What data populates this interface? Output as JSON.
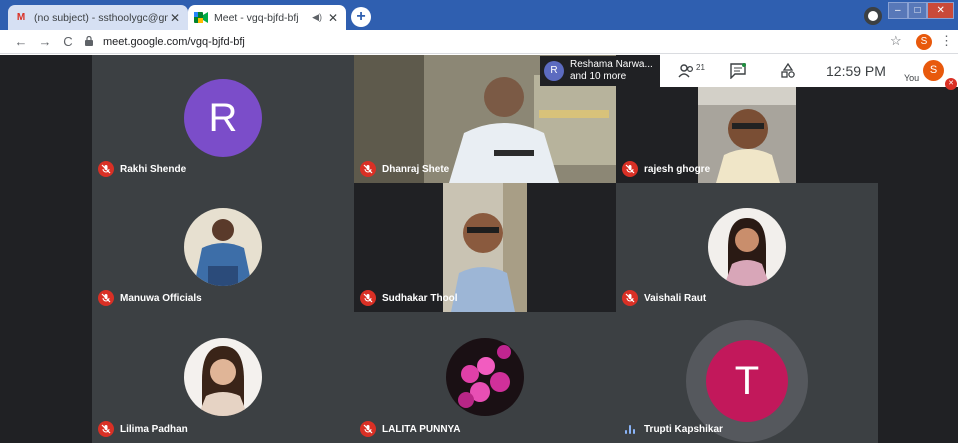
{
  "browser": {
    "tabs": [
      {
        "title": "(no subject) - ssthoolygc@gmail",
        "favicon": "gmail-icon",
        "active": false
      },
      {
        "title": "Meet - vgq-bjfd-bfj",
        "favicon": "meet-icon",
        "active": true
      }
    ],
    "url": "meet.google.com/vgq-bjfd-bfj",
    "profile_initial": "S"
  },
  "meet": {
    "presenter": {
      "initial": "R",
      "line1": "Reshama Narwa...",
      "line2": "and 10 more"
    },
    "people_count": "21",
    "time": "12:59 PM",
    "you_label": "You",
    "self_initial": "S",
    "participants": [
      {
        "name": "Rakhi Shende",
        "initial": "R",
        "muted": true
      },
      {
        "name": "Dhanraj Shete",
        "muted": true
      },
      {
        "name": "rajesh ghogre",
        "muted": true
      },
      {
        "name": "Manuwa Officials",
        "muted": true
      },
      {
        "name": "Sudhakar Thool",
        "muted": true
      },
      {
        "name": "Vaishali Raut",
        "muted": true
      },
      {
        "name": "Lilima Padhan",
        "muted": true
      },
      {
        "name": "LALITA PUNNYA",
        "muted": true
      },
      {
        "name": "Trupti Kapshikar",
        "initial": "T",
        "muted": false
      }
    ]
  },
  "colors": {
    "meet_bg": "#202124",
    "tile_bg": "#3c4043",
    "avatar_purple": "#7b4dc9",
    "avatar_pink": "#c2185b",
    "mute_red": "#d93025"
  }
}
